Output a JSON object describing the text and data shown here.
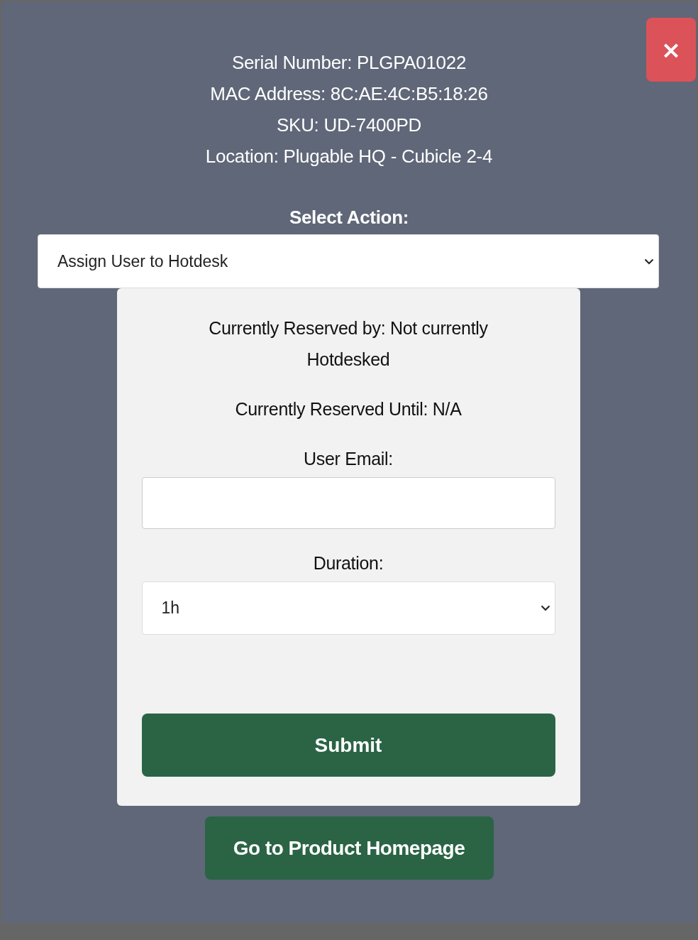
{
  "close_button": {
    "label": "×"
  },
  "device_info": [
    "Serial Number: PLGPA01022",
    "MAC Address: 8C:AE:4C:B5:18:26",
    "SKU: UD-7400PD",
    "Location: Plugable HQ - Cubicle 2-4"
  ],
  "action": {
    "label": "Select Action:",
    "value": "Assign User to Hotdesk"
  },
  "card": {
    "reserved_by": "Currently Reserved by: Not currently Hotdesked",
    "reserved_until": "Currently Reserved Until: N/A",
    "email": {
      "label": "User Email:"
    },
    "duration": {
      "label": "Duration:",
      "value": "1h"
    },
    "submit": "Submit"
  },
  "homepage_button": "Go to Product Homepage"
}
